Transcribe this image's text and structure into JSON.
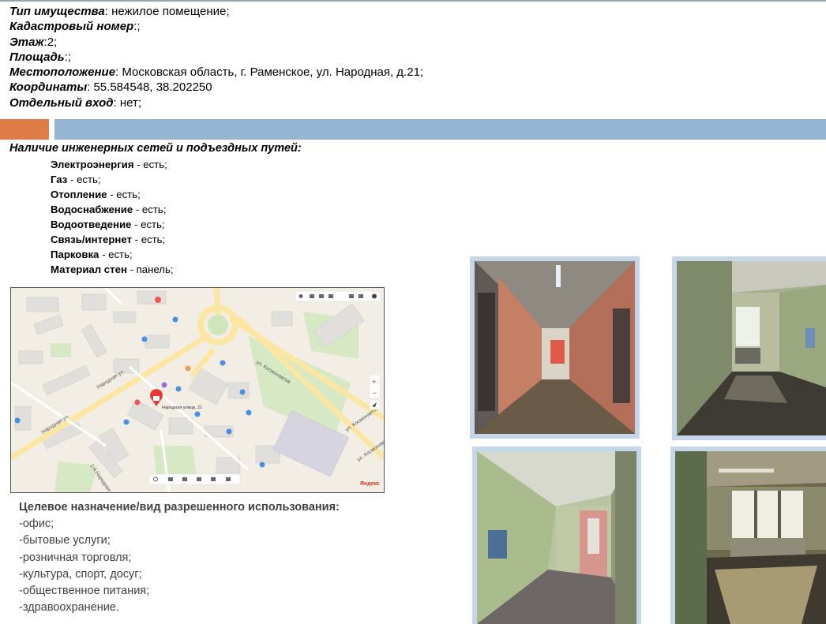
{
  "properties": [
    {
      "label": "Тип имущества",
      "sep": ": ",
      "value": "нежилое помещение;"
    },
    {
      "label": "Кадастровый номер",
      "sep": ":",
      "value": ";"
    },
    {
      "label": "Этаж",
      "sep": ":",
      "value": "2;"
    },
    {
      "label": "Площадь",
      "sep": ":",
      "value": ";"
    },
    {
      "label": "Местоположение",
      "sep": ": ",
      "value": "Московская область, г. Раменское, ул. Народная, д.21;"
    },
    {
      "label": "Координаты",
      "sep": ": ",
      "value": "55.584548, 38.202250"
    },
    {
      "label": "Отдельный вход",
      "sep": ": ",
      "value": "нет;"
    }
  ],
  "utilities": {
    "title": "Наличие инженерных сетей и подъездных путей:",
    "items": [
      {
        "name": "Электроэнергия",
        "value": " - есть;"
      },
      {
        "name": "Газ",
        "value": " - есть;"
      },
      {
        "name": "Отопление",
        "value": " - есть;"
      },
      {
        "name": "Водоснабжение",
        "value": " - есть;"
      },
      {
        "name": "Водоотведение",
        "value": " - есть;"
      },
      {
        "name": "Связь/интернет",
        "value": " - есть;"
      },
      {
        "name": "Парковка",
        "value": " - есть;"
      },
      {
        "name": "Материал стен",
        "value": " - панель;"
      }
    ]
  },
  "map": {
    "street_labels": [
      "Народная ул.",
      "ул. Космонавтов",
      "ул. Космонавтов",
      "ул. Космонавтов",
      "Народная ул.",
      "1-я Народная ул."
    ],
    "address_label": "Народная улица, 21",
    "brand": "Яндекс"
  },
  "purpose": {
    "heading": "Целевое назначение/вид разрешенного использования:",
    "items": [
      "-офис;",
      "-бытовые услуги;",
      "-розничная торговля;",
      "-культура, спорт, досуг;",
      "-общественное питания;",
      "-здравоохранение."
    ]
  },
  "colors": {
    "accent_orange": "#e07c45",
    "accent_blue": "#94b6d3",
    "photo_frame": "#c5d6e8"
  }
}
